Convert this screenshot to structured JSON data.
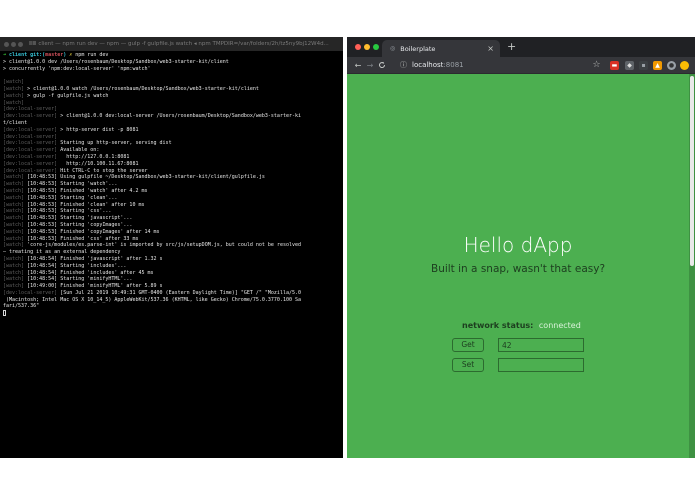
{
  "terminal": {
    "title": "ⅢⅢ client — npm run dev — npm — gulp -f gulpfile.js watch ◂ npm TMPDIR=/var/folders/2h/tz5ny9bj12W4d...",
    "prompt": {
      "arrow": "➜",
      "dir": "client",
      "git": "git:(",
      "branch": "master",
      "git_close": ")",
      "x": "✗",
      "command": "npm run dev"
    },
    "lines": [
      "> client@1.0.0 dev /Users/rosenbaum/Desktop/Sandbox/web3-starter-kit/client",
      "> concurrently 'npm:dev:local-server' 'npm:watch'",
      "",
      "[watch]",
      "[watch] > client@1.0.0 watch /Users/rosenbaum/Desktop/Sandbox/web3-starter-kit/client",
      "[watch] > gulp -f gulpfile.js watch",
      "[watch]",
      "[dev:local-server]",
      "[dev:local-server] > client@1.0.0 dev:local-server /Users/rosenbaum/Desktop/Sandbox/web3-starter-ki",
      "t/client",
      "[dev:local-server] > http-server dist -p 8081",
      "[dev:local-server]",
      "[dev:local-server] Starting up http-server, serving dist",
      "[dev:local-server] Available on:",
      "[dev:local-server]   http://127.0.0.1:8081",
      "[dev:local-server]   http://10.100.11.67:8081",
      "[dev:local-server] Hit CTRL-C to stop the server",
      "[watch] [10:48:53] Using gulpfile ~/Desktop/Sandbox/web3-starter-kit/client/gulpfile.js",
      "[watch] [10:48:53] Starting 'watch'...",
      "[watch] [10:48:53] Finished 'watch' after 4.2 ms",
      "[watch] [10:48:53] Starting 'clean'...",
      "[watch] [10:48:53] Finished 'clean' after 10 ms",
      "[watch] [10:48:53] Starting 'css'...",
      "[watch] [10:48:53] Starting 'javascript'...",
      "[watch] [10:48:53] Starting 'copyImages'...",
      "[watch] [10:48:53] Finished 'copyImages' after 14 ms",
      "[watch] [10:48:53] Finished 'css' after 33 ms",
      "[watch] 'core-js/modules/es.parse-int' is imported by src/js/setupDOM.js, but could not be resolved",
      "— treating it as an external dependency",
      "[watch] [10:48:54] Finished 'javascript' after 1.32 s",
      "[watch] [10:48:54] Starting 'includes'...",
      "[watch] [10:48:54] Finished 'includes' after 45 ms",
      "[watch] [10:48:54] Starting 'minifyHTML'...",
      "[watch] [10:49:00] Finished 'minifyHTML' after 5.89 s",
      "[dev:local-server] [Sun Jul 21 2019 10:49:31 GMT-0400 (Eastern Daylight Time)] \"GET /\" \"Mozilla/5.0",
      " (Macintosh; Intel Mac OS X 10_14_5) AppleWebKit/537.36 (KHTML, like Gecko) Chrome/75.0.3770.100 Sa",
      "fari/537.36\""
    ]
  },
  "browser": {
    "tab_title": "Boilerplate",
    "tab_close": "×",
    "new_tab": "+",
    "url_host": "localhost",
    "url_port": ":8081",
    "nav": {
      "back": "←",
      "forward": "→",
      "reload": "C"
    },
    "star": "☆"
  },
  "dapp": {
    "heading": "Hello dApp",
    "tagline": "Built in a snap, wasn't that easy?",
    "status_label": "network status:",
    "status_value": "connected",
    "get_label": "Get",
    "get_value": "42",
    "set_label": "Set",
    "set_value": ""
  },
  "colors": {
    "page_green": "#4caf50",
    "terminal_bg": "#000000",
    "prompt_green": "#3ad33a",
    "prompt_cyan": "#37c3d6",
    "chrome_dark": "#202124"
  }
}
